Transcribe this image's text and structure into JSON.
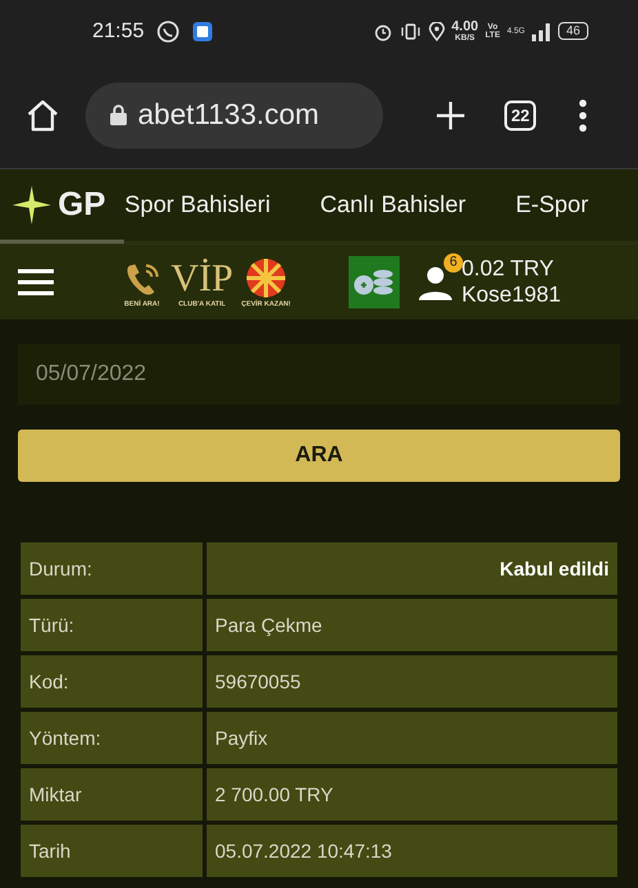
{
  "status_bar": {
    "time": "21:55",
    "speed": "4.00",
    "speed_unit": "KB/S",
    "volte_top": "Vo",
    "volte_bottom": "LTE",
    "network": "4.5G",
    "battery": "46"
  },
  "browser": {
    "url": "abet1133.com",
    "tab_count": "22"
  },
  "nav": {
    "logo": "GP",
    "tabs": [
      {
        "label": "Spor Bahisleri"
      },
      {
        "label": "Canlı Bahisler"
      },
      {
        "label": "E-Spor"
      }
    ]
  },
  "header": {
    "promos": [
      {
        "kind": "call",
        "caption": "BENİ ARA!"
      },
      {
        "kind": "vip",
        "title": "VİP",
        "caption": "CLUB'A KATIL"
      },
      {
        "kind": "wheel",
        "caption": "ÇEVİR KAZAN!"
      }
    ],
    "badge": "6",
    "balance": "0.02 TRY",
    "username": "Kose1981"
  },
  "filter": {
    "date": "05/07/2022",
    "button": "ARA"
  },
  "details": [
    {
      "label": "Durum:",
      "value": "Kabul edildi",
      "emphasis": true
    },
    {
      "label": "Türü:",
      "value": "Para Çekme",
      "emphasis": false
    },
    {
      "label": "Kod:",
      "value": "59670055",
      "emphasis": false
    },
    {
      "label": "Yöntem:",
      "value": "Payfix",
      "emphasis": false
    },
    {
      "label": "Miktar",
      "value": "2 700.00 TRY",
      "emphasis": false
    },
    {
      "label": "Tarih",
      "value": "05.07.2022 10:47:13",
      "emphasis": false
    }
  ]
}
